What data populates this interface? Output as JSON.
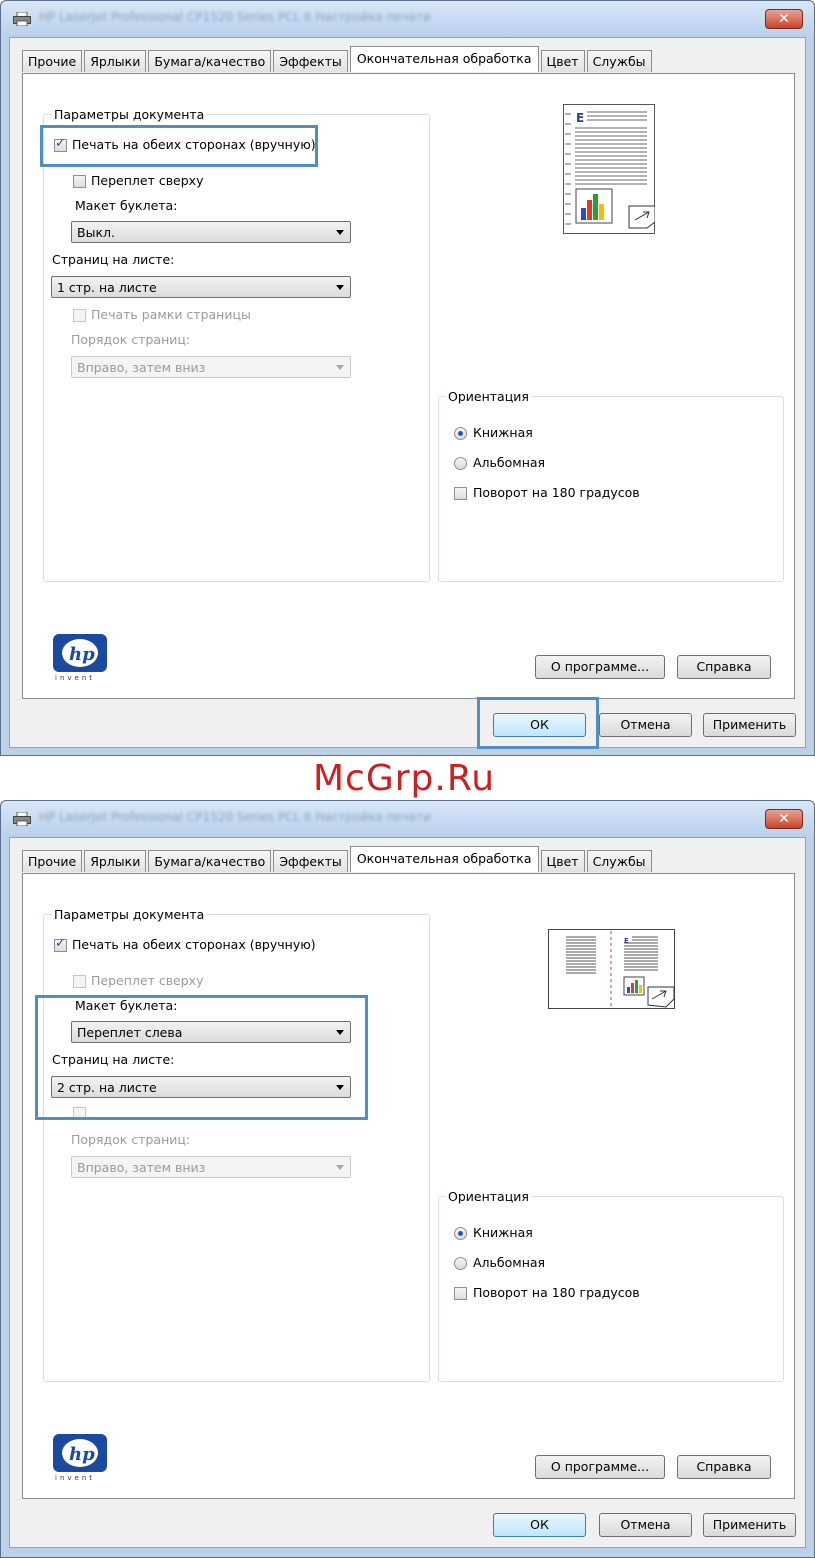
{
  "watermark": "McGrp.Ru",
  "screens": [
    {
      "window": {
        "title": "HP LaserJet Professional CP1520 Series PCL 6 Настройка печати",
        "close_label": "✕"
      },
      "tabs": [
        "Прочие",
        "Ярлыки",
        "Бумага/качество",
        "Эффекты",
        "Окончательная обработка",
        "Цвет",
        "Службы"
      ],
      "active_tab": "Окончательная обработка",
      "document_options": {
        "group_label": "Параметры документа",
        "duplex_label": "Печать на обеих сторонах (вручную)",
        "duplex_checked": true,
        "flip_label": "Переплет сверху",
        "flip_checked": false,
        "booklet_label": "Макет буклета:",
        "booklet_value": "Выкл.",
        "pages_per_sheet_label": "Страниц на листе:",
        "pages_per_sheet_value": "1 стр. на листе",
        "borders_label": "Печать рамки страницы",
        "page_order_label": "Порядок страниц:",
        "page_order_value": "Вправо, затем вниз"
      },
      "orientation": {
        "group_label": "Ориентация",
        "portrait_label": "Книжная",
        "portrait_checked": true,
        "landscape_label": "Альбомная",
        "rotate_label": "Поворот на 180 градусов",
        "rotate_checked": false
      },
      "buttons": {
        "about": "О программе...",
        "help": "Справка",
        "ok": "ОК",
        "cancel": "Отмена",
        "apply": "Применить"
      },
      "logo_text": "invent"
    },
    {
      "window": {
        "title": "HP LaserJet Professional CP1520 Series PCL 6 Настройка печати",
        "close_label": "✕"
      },
      "tabs": [
        "Прочие",
        "Ярлыки",
        "Бумага/качество",
        "Эффекты",
        "Окончательная обработка",
        "Цвет",
        "Службы"
      ],
      "active_tab": "Окончательная обработка",
      "document_options": {
        "group_label": "Параметры документа",
        "duplex_label": "Печать на обеих сторонах (вручную)",
        "duplex_checked": true,
        "flip_label": "Переплет сверху",
        "flip_checked": false,
        "booklet_label": "Макет буклета:",
        "booklet_value": "Переплет слева",
        "pages_per_sheet_label": "Страниц на листе:",
        "pages_per_sheet_value": "2 стр. на листе",
        "page_order_label": "Порядок страниц:",
        "page_order_value": "Вправо, затем вниз"
      },
      "orientation": {
        "group_label": "Ориентация",
        "portrait_label": "Книжная",
        "portrait_checked": true,
        "landscape_label": "Альбомная",
        "rotate_label": "Поворот на 180 градусов",
        "rotate_checked": false
      },
      "buttons": {
        "about": "О программе...",
        "help": "Справка",
        "ok": "ОК",
        "cancel": "Отмена",
        "apply": "Применить"
      },
      "logo_text": "invent"
    }
  ]
}
